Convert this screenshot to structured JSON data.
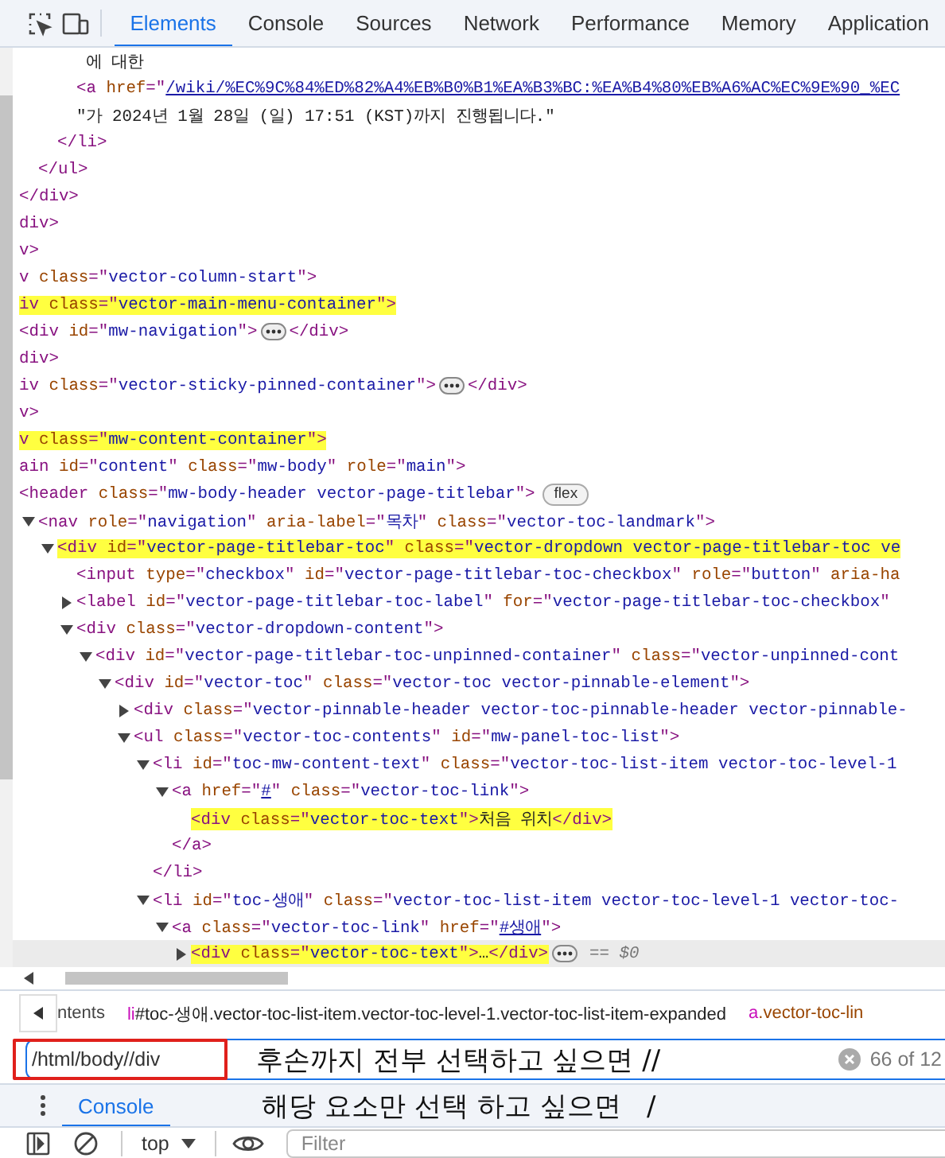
{
  "toolbar": {
    "tabs": [
      {
        "label": "Elements",
        "selected": true
      },
      {
        "label": "Console",
        "selected": false
      },
      {
        "label": "Sources",
        "selected": false
      },
      {
        "label": "Network",
        "selected": false
      },
      {
        "label": "Performance",
        "selected": false
      },
      {
        "label": "Memory",
        "selected": false
      },
      {
        "label": "Application",
        "selected": false
      }
    ]
  },
  "elements": {
    "lines": [
      {
        "tokens": [
          {
            "kind": "text",
            "text": "       에 대한"
          }
        ],
        "highlighted": false,
        "selected": false
      },
      {
        "tokens": [
          {
            "kind": "tag",
            "text": "      <a "
          },
          {
            "kind": "attr",
            "text": "href"
          },
          {
            "kind": "tag",
            "text": "=\""
          },
          {
            "kind": "link",
            "text": "/wiki/%EC%9C%84%ED%82%A4%EB%B0%B1%EA%B3%BC:%EA%B4%80%EB%A6%AC%EC%9E%90_%EC"
          }
        ],
        "highlighted": false,
        "selected": false
      },
      {
        "tokens": [
          {
            "kind": "text",
            "text": "      \"가 2024년 1월 28일 (일) 17:51 (KST)까지 진행됩니다.\""
          }
        ],
        "highlighted": false,
        "selected": false
      },
      {
        "tokens": [
          {
            "kind": "tag",
            "text": "    </li>"
          }
        ],
        "highlighted": false,
        "selected": false
      },
      {
        "tokens": [
          {
            "kind": "tag",
            "text": "  </ul>"
          }
        ],
        "highlighted": false,
        "selected": false
      },
      {
        "tokens": [
          {
            "kind": "tag",
            "text": "</div>"
          }
        ],
        "highlighted": false,
        "selected": false
      },
      {
        "tokens": [
          {
            "kind": "tag",
            "text": "div>"
          }
        ],
        "highlighted": false,
        "selected": false
      },
      {
        "tokens": [
          {
            "kind": "tag",
            "text": "v>"
          }
        ],
        "highlighted": false,
        "selected": false
      },
      {
        "tokens": [
          {
            "kind": "tag",
            "text": "v "
          },
          {
            "kind": "attr",
            "text": "class"
          },
          {
            "kind": "tag",
            "text": "=\""
          },
          {
            "kind": "value",
            "text": "vector-column-start"
          },
          {
            "kind": "tag",
            "text": "\">"
          }
        ],
        "highlighted": false,
        "selected": false
      },
      {
        "tokens": [
          {
            "kind": "tag",
            "text": "iv "
          },
          {
            "kind": "attr",
            "text": "class"
          },
          {
            "kind": "tag",
            "text": "=\""
          },
          {
            "kind": "value",
            "text": "vector-main-menu-container"
          },
          {
            "kind": "tag",
            "text": "\">"
          }
        ],
        "highlighted": true,
        "selected": false
      },
      {
        "tokens": [
          {
            "kind": "tag",
            "text": "<div "
          },
          {
            "kind": "attr",
            "text": "id"
          },
          {
            "kind": "tag",
            "text": "=\""
          },
          {
            "kind": "value",
            "text": "mw-navigation"
          },
          {
            "kind": "tag",
            "text": "\">"
          },
          {
            "kind": "more"
          },
          {
            "kind": "tag",
            "text": "</div>"
          }
        ],
        "highlighted": false,
        "selected": false
      },
      {
        "tokens": [
          {
            "kind": "tag",
            "text": "div>"
          }
        ],
        "highlighted": false,
        "selected": false
      },
      {
        "tokens": [
          {
            "kind": "tag",
            "text": "iv "
          },
          {
            "kind": "attr",
            "text": "class"
          },
          {
            "kind": "tag",
            "text": "=\""
          },
          {
            "kind": "value",
            "text": "vector-sticky-pinned-container"
          },
          {
            "kind": "tag",
            "text": "\">"
          },
          {
            "kind": "more"
          },
          {
            "kind": "tag",
            "text": "</div>"
          }
        ],
        "highlighted": false,
        "selected": false
      },
      {
        "tokens": [
          {
            "kind": "tag",
            "text": "v>"
          }
        ],
        "highlighted": false,
        "selected": false
      },
      {
        "tokens": [
          {
            "kind": "tag",
            "text": "v "
          },
          {
            "kind": "attr",
            "text": "class"
          },
          {
            "kind": "tag",
            "text": "=\""
          },
          {
            "kind": "value",
            "text": "mw-content-container"
          },
          {
            "kind": "tag",
            "text": "\">"
          }
        ],
        "highlighted": true,
        "selected": false
      },
      {
        "tokens": [
          {
            "kind": "tag",
            "text": "ain "
          },
          {
            "kind": "attr",
            "text": "id"
          },
          {
            "kind": "tag",
            "text": "=\""
          },
          {
            "kind": "value",
            "text": "content"
          },
          {
            "kind": "tag",
            "text": "\" "
          },
          {
            "kind": "attr",
            "text": "class"
          },
          {
            "kind": "tag",
            "text": "=\""
          },
          {
            "kind": "value",
            "text": "mw-body"
          },
          {
            "kind": "tag",
            "text": "\" "
          },
          {
            "kind": "attr",
            "text": "role"
          },
          {
            "kind": "tag",
            "text": "=\""
          },
          {
            "kind": "value",
            "text": "main"
          },
          {
            "kind": "tag",
            "text": "\">"
          }
        ],
        "highlighted": false,
        "selected": false
      },
      {
        "tokens": [
          {
            "kind": "tag",
            "text": "<header "
          },
          {
            "kind": "attr",
            "text": "class"
          },
          {
            "kind": "tag",
            "text": "=\""
          },
          {
            "kind": "value",
            "text": "mw-body-header vector-page-titlebar"
          },
          {
            "kind": "tag",
            "text": "\">"
          },
          {
            "kind": "badge",
            "text": "flex"
          }
        ],
        "highlighted": false,
        "selected": false
      },
      {
        "tokens": [
          {
            "kind": "tag",
            "text": "  <nav "
          },
          {
            "kind": "attr",
            "text": "role"
          },
          {
            "kind": "tag",
            "text": "=\""
          },
          {
            "kind": "value",
            "text": "navigation"
          },
          {
            "kind": "tag",
            "text": "\" "
          },
          {
            "kind": "attr",
            "text": "aria-label"
          },
          {
            "kind": "tag",
            "text": "=\""
          },
          {
            "kind": "value",
            "text": "목차"
          },
          {
            "kind": "tag",
            "text": "\" "
          },
          {
            "kind": "attr",
            "text": "class"
          },
          {
            "kind": "tag",
            "text": "=\""
          },
          {
            "kind": "value",
            "text": "vector-toc-landmark"
          },
          {
            "kind": "tag",
            "text": "\">"
          }
        ],
        "expanded": true,
        "highlighted": false,
        "selected": false
      },
      {
        "tokens": [
          {
            "kind": "tag",
            "text": "    <div "
          },
          {
            "kind": "attr",
            "text": "id"
          },
          {
            "kind": "tag",
            "text": "=\""
          },
          {
            "kind": "value",
            "text": "vector-page-titlebar-toc"
          },
          {
            "kind": "tag",
            "text": "\" "
          },
          {
            "kind": "attr",
            "text": "class"
          },
          {
            "kind": "tag",
            "text": "=\""
          },
          {
            "kind": "value",
            "text": "vector-dropdown vector-page-titlebar-toc ve"
          }
        ],
        "expanded": true,
        "highlighted": true,
        "selected": false
      },
      {
        "tokens": [
          {
            "kind": "tag",
            "text": "      <input "
          },
          {
            "kind": "attr",
            "text": "type"
          },
          {
            "kind": "tag",
            "text": "=\""
          },
          {
            "kind": "value",
            "text": "checkbox"
          },
          {
            "kind": "tag",
            "text": "\" "
          },
          {
            "kind": "attr",
            "text": "id"
          },
          {
            "kind": "tag",
            "text": "=\""
          },
          {
            "kind": "value",
            "text": "vector-page-titlebar-toc-checkbox"
          },
          {
            "kind": "tag",
            "text": "\" "
          },
          {
            "kind": "attr",
            "text": "role"
          },
          {
            "kind": "tag",
            "text": "=\""
          },
          {
            "kind": "value",
            "text": "button"
          },
          {
            "kind": "tag",
            "text": "\" "
          },
          {
            "kind": "attr",
            "text": "aria-ha"
          }
        ],
        "highlighted": false,
        "selected": false
      },
      {
        "tokens": [
          {
            "kind": "tag",
            "text": "      <label "
          },
          {
            "kind": "attr",
            "text": "id"
          },
          {
            "kind": "tag",
            "text": "=\""
          },
          {
            "kind": "value",
            "text": "vector-page-titlebar-toc-label"
          },
          {
            "kind": "tag",
            "text": "\" "
          },
          {
            "kind": "attr",
            "text": "for"
          },
          {
            "kind": "tag",
            "text": "=\""
          },
          {
            "kind": "value",
            "text": "vector-page-titlebar-toc-checkbox"
          },
          {
            "kind": "tag",
            "text": "\""
          }
        ],
        "expanded": false,
        "highlighted": false,
        "selected": false
      },
      {
        "tokens": [
          {
            "kind": "tag",
            "text": "      <div "
          },
          {
            "kind": "attr",
            "text": "class"
          },
          {
            "kind": "tag",
            "text": "=\""
          },
          {
            "kind": "value",
            "text": "vector-dropdown-content"
          },
          {
            "kind": "tag",
            "text": "\">"
          }
        ],
        "expanded": true,
        "highlighted": false,
        "selected": false
      },
      {
        "tokens": [
          {
            "kind": "tag",
            "text": "        <div "
          },
          {
            "kind": "attr",
            "text": "id"
          },
          {
            "kind": "tag",
            "text": "=\""
          },
          {
            "kind": "value",
            "text": "vector-page-titlebar-toc-unpinned-container"
          },
          {
            "kind": "tag",
            "text": "\" "
          },
          {
            "kind": "attr",
            "text": "class"
          },
          {
            "kind": "tag",
            "text": "=\""
          },
          {
            "kind": "value",
            "text": "vector-unpinned-cont"
          }
        ],
        "expanded": true,
        "highlighted": false,
        "selected": false
      },
      {
        "tokens": [
          {
            "kind": "tag",
            "text": "          <div "
          },
          {
            "kind": "attr",
            "text": "id"
          },
          {
            "kind": "tag",
            "text": "=\""
          },
          {
            "kind": "value",
            "text": "vector-toc"
          },
          {
            "kind": "tag",
            "text": "\" "
          },
          {
            "kind": "attr",
            "text": "class"
          },
          {
            "kind": "tag",
            "text": "=\""
          },
          {
            "kind": "value",
            "text": "vector-toc vector-pinnable-element"
          },
          {
            "kind": "tag",
            "text": "\">"
          }
        ],
        "expanded": true,
        "highlighted": false,
        "selected": false
      },
      {
        "tokens": [
          {
            "kind": "tag",
            "text": "            <div "
          },
          {
            "kind": "attr",
            "text": "class"
          },
          {
            "kind": "tag",
            "text": "=\""
          },
          {
            "kind": "value",
            "text": "vector-pinnable-header vector-toc-pinnable-header vector-pinnable-"
          }
        ],
        "expanded": false,
        "highlighted": false,
        "selected": false
      },
      {
        "tokens": [
          {
            "kind": "tag",
            "text": "            <ul "
          },
          {
            "kind": "attr",
            "text": "class"
          },
          {
            "kind": "tag",
            "text": "=\""
          },
          {
            "kind": "value",
            "text": "vector-toc-contents"
          },
          {
            "kind": "tag",
            "text": "\" "
          },
          {
            "kind": "attr",
            "text": "id"
          },
          {
            "kind": "tag",
            "text": "=\""
          },
          {
            "kind": "value",
            "text": "mw-panel-toc-list"
          },
          {
            "kind": "tag",
            "text": "\">"
          }
        ],
        "expanded": true,
        "highlighted": false,
        "selected": false
      },
      {
        "tokens": [
          {
            "kind": "tag",
            "text": "              <li "
          },
          {
            "kind": "attr",
            "text": "id"
          },
          {
            "kind": "tag",
            "text": "=\""
          },
          {
            "kind": "value",
            "text": "toc-mw-content-text"
          },
          {
            "kind": "tag",
            "text": "\" "
          },
          {
            "kind": "attr",
            "text": "class"
          },
          {
            "kind": "tag",
            "text": "=\""
          },
          {
            "kind": "value",
            "text": "vector-toc-list-item vector-toc-level-1"
          }
        ],
        "expanded": true,
        "highlighted": false,
        "selected": false
      },
      {
        "tokens": [
          {
            "kind": "tag",
            "text": "                <a "
          },
          {
            "kind": "attr",
            "text": "href"
          },
          {
            "kind": "tag",
            "text": "=\""
          },
          {
            "kind": "link",
            "text": "#"
          },
          {
            "kind": "tag",
            "text": "\" "
          },
          {
            "kind": "attr",
            "text": "class"
          },
          {
            "kind": "tag",
            "text": "=\""
          },
          {
            "kind": "value",
            "text": "vector-toc-link"
          },
          {
            "kind": "tag",
            "text": "\">"
          }
        ],
        "expanded": true,
        "highlighted": false,
        "selected": false
      },
      {
        "tokens": [
          {
            "kind": "tag",
            "text": "                  <div "
          },
          {
            "kind": "attr",
            "text": "class"
          },
          {
            "kind": "tag",
            "text": "=\""
          },
          {
            "kind": "value",
            "text": "vector-toc-text"
          },
          {
            "kind": "tag",
            "text": "\">"
          },
          {
            "kind": "text",
            "text": "처음 위치"
          },
          {
            "kind": "tag",
            "text": "</div>"
          }
        ],
        "highlighted": true,
        "selected": false
      },
      {
        "tokens": [
          {
            "kind": "tag",
            "text": "                </a>"
          }
        ],
        "highlighted": false,
        "selected": false
      },
      {
        "tokens": [
          {
            "kind": "tag",
            "text": "              </li>"
          }
        ],
        "highlighted": false,
        "selected": false
      },
      {
        "tokens": [
          {
            "kind": "tag",
            "text": "              <li "
          },
          {
            "kind": "attr",
            "text": "id"
          },
          {
            "kind": "tag",
            "text": "=\""
          },
          {
            "kind": "value",
            "text": "toc-생애"
          },
          {
            "kind": "tag",
            "text": "\" "
          },
          {
            "kind": "attr",
            "text": "class"
          },
          {
            "kind": "tag",
            "text": "=\""
          },
          {
            "kind": "value",
            "text": "vector-toc-list-item vector-toc-level-1 vector-toc-"
          }
        ],
        "expanded": true,
        "highlighted": false,
        "selected": false
      },
      {
        "tokens": [
          {
            "kind": "tag",
            "text": "                <a "
          },
          {
            "kind": "attr",
            "text": "class"
          },
          {
            "kind": "tag",
            "text": "=\""
          },
          {
            "kind": "value",
            "text": "vector-toc-link"
          },
          {
            "kind": "tag",
            "text": "\" "
          },
          {
            "kind": "attr",
            "text": "href"
          },
          {
            "kind": "tag",
            "text": "=\""
          },
          {
            "kind": "link",
            "text": "#생애"
          },
          {
            "kind": "tag",
            "text": "\">"
          }
        ],
        "expanded": true,
        "highlighted": false,
        "selected": false
      },
      {
        "tokens": [
          {
            "kind": "tag",
            "text": "                  <div "
          },
          {
            "kind": "attr",
            "text": "class"
          },
          {
            "kind": "tag",
            "text": "=\""
          },
          {
            "kind": "value",
            "text": "vector-toc-text"
          },
          {
            "kind": "tag",
            "text": "\">"
          },
          {
            "kind": "text",
            "text": "…"
          },
          {
            "kind": "tag",
            "text": "</div>"
          },
          {
            "kind": "more"
          },
          {
            "kind": "note",
            "text": "== $0"
          }
        ],
        "expanded": false,
        "highlighted": true,
        "selected": true
      }
    ]
  },
  "breadcrumbs": [
    {
      "parts": [
        {
          "kind": "plain",
          "text": "ntents"
        }
      ]
    },
    {
      "parts": [
        {
          "kind": "tag",
          "text": "li"
        },
        {
          "kind": "plain",
          "text": "#toc-생애.vector-toc-list-item.vector-toc-level-1.vector-toc-list-item-expanded"
        }
      ]
    },
    {
      "parts": [
        {
          "kind": "tag",
          "text": "a"
        },
        {
          "kind": "class",
          "text": ".vector-toc-lin"
        }
      ]
    }
  ],
  "search": {
    "value": "/html/body//div",
    "annotation": "후손까지 전부 선택하고 싶으면 //",
    "match_count": "66 of 12"
  },
  "drawer": {
    "tabs": [
      {
        "label": "Console",
        "selected": true
      }
    ],
    "annotation": "해당 요소만 선택 하고 싶으면   /"
  },
  "console_toolbar": {
    "context": "top",
    "filter_placeholder": "Filter"
  }
}
